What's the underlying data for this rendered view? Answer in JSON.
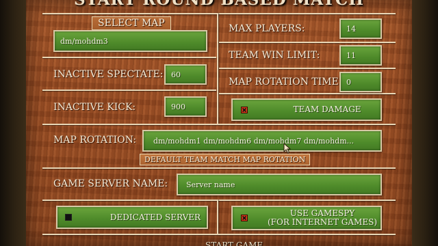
{
  "title": "START ROUND BASED MATCH",
  "select_map": {
    "label": "SELECT MAP",
    "value": "dm/mohdm3"
  },
  "max_players": {
    "label": "MAX PLAYERS:",
    "value": "14"
  },
  "team_win_limit": {
    "label": "TEAM WIN LIMIT:",
    "value": "11"
  },
  "inactive_spectate": {
    "label": "INACTIVE SPECTATE:",
    "value": "60"
  },
  "map_rotation_time": {
    "label": "MAP ROTATION TIME:",
    "value": "0"
  },
  "inactive_kick": {
    "label": "INACTIVE KICK:",
    "value": "900"
  },
  "team_damage": {
    "label": "TEAM DAMAGE",
    "checked": true
  },
  "map_rotation": {
    "label": "MAP ROTATION:",
    "value": "dm/mohdm1 dm/mohdm6 dm/mohdm7 dm/mohdm...",
    "default_button": "DEFAULT TEAM MATCH MAP ROTATION"
  },
  "game_server_name": {
    "label": "GAME SERVER NAME:",
    "value": "Server name"
  },
  "dedicated_server": {
    "label": "DEDICATED SERVER",
    "checked": false
  },
  "use_gamespy": {
    "line1": "USE GAMESPY",
    "line2": "(FOR INTERNET GAMES)",
    "checked": true
  },
  "start_game": "START GAME",
  "colors": {
    "wood": "#9b4d24",
    "field_green": "#4e8a2a",
    "label_text": "#f4ead6",
    "checkbox_checked": "#d83a1a"
  }
}
